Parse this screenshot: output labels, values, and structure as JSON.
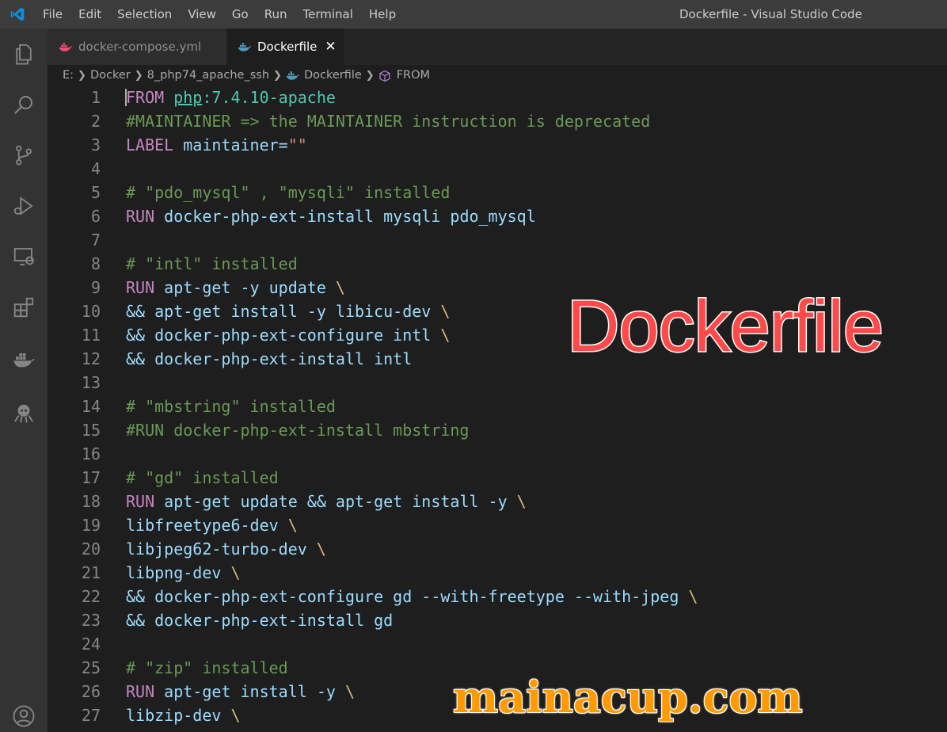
{
  "titlebar": {
    "menu": [
      "File",
      "Edit",
      "Selection",
      "View",
      "Go",
      "Run",
      "Terminal",
      "Help"
    ],
    "window_title": "Dockerfile - Visual Studio Code"
  },
  "activitybar": {
    "icons": [
      "explorer-icon",
      "search-icon",
      "source-control-icon",
      "run-debug-icon",
      "remote-explorer-icon",
      "extensions-icon",
      "docker-icon",
      "github-octocat-icon",
      "account-icon"
    ]
  },
  "tabs": [
    {
      "label": "docker-compose.yml",
      "active": false,
      "icon": "docker-pink-icon"
    },
    {
      "label": "Dockerfile",
      "active": true,
      "icon": "docker-blue-icon",
      "close": "✕"
    }
  ],
  "breadcrumb": [
    "E:",
    "Docker",
    "8_php74_apache_ssh",
    "Dockerfile",
    "FROM"
  ],
  "colors": {
    "keyword": "#c586c0",
    "comment": "#6a9955",
    "text": "#9cdcfe",
    "string": "#ce9178",
    "image": "#4ec9b0",
    "backslash": "#d7ba7d"
  },
  "lines": [
    {
      "n": "1",
      "tokens": [
        {
          "t": "FROM",
          "c": "kw"
        },
        {
          "t": " ",
          "c": "plain"
        },
        {
          "t": "php",
          "c": "img underline"
        },
        {
          "t": ":7.4.10-apache",
          "c": "img"
        }
      ]
    },
    {
      "n": "2",
      "tokens": [
        {
          "t": "#MAINTAINER => the MAINTAINER instruction is deprecated",
          "c": "cm"
        }
      ]
    },
    {
      "n": "3",
      "tokens": [
        {
          "t": "LABEL",
          "c": "kw"
        },
        {
          "t": " maintainer=",
          "c": "tx"
        },
        {
          "t": "\"\"",
          "c": "st"
        }
      ]
    },
    {
      "n": "4",
      "tokens": []
    },
    {
      "n": "5",
      "tokens": [
        {
          "t": "# \"pdo_mysql\" , \"mysqli\" installed",
          "c": "cm"
        }
      ]
    },
    {
      "n": "6",
      "tokens": [
        {
          "t": "RUN",
          "c": "kw"
        },
        {
          "t": " docker-php-ext-install mysqli pdo_mysql",
          "c": "tx"
        }
      ]
    },
    {
      "n": "7",
      "tokens": []
    },
    {
      "n": "8",
      "tokens": [
        {
          "t": "# \"intl\" installed",
          "c": "cm"
        }
      ]
    },
    {
      "n": "9",
      "tokens": [
        {
          "t": "RUN",
          "c": "kw"
        },
        {
          "t": " apt-get -y update ",
          "c": "tx"
        },
        {
          "t": "\\",
          "c": "bs"
        }
      ]
    },
    {
      "n": "10",
      "tokens": [
        {
          "t": "&& apt-get install -y libicu-dev ",
          "c": "tx"
        },
        {
          "t": "\\",
          "c": "bs"
        }
      ]
    },
    {
      "n": "11",
      "tokens": [
        {
          "t": "&& docker-php-ext-configure intl ",
          "c": "tx"
        },
        {
          "t": "\\",
          "c": "bs"
        }
      ]
    },
    {
      "n": "12",
      "tokens": [
        {
          "t": "&& docker-php-ext-install intl",
          "c": "tx"
        }
      ]
    },
    {
      "n": "13",
      "tokens": []
    },
    {
      "n": "14",
      "tokens": [
        {
          "t": "# \"mbstring\" installed",
          "c": "cm"
        }
      ]
    },
    {
      "n": "15",
      "tokens": [
        {
          "t": "#RUN docker-php-ext-install mbstring",
          "c": "cm"
        }
      ]
    },
    {
      "n": "16",
      "tokens": []
    },
    {
      "n": "17",
      "tokens": [
        {
          "t": "# \"gd\" installed",
          "c": "cm"
        }
      ]
    },
    {
      "n": "18",
      "tokens": [
        {
          "t": "RUN",
          "c": "kw"
        },
        {
          "t": " apt-get update && apt-get install -y ",
          "c": "tx"
        },
        {
          "t": "\\",
          "c": "bs"
        }
      ]
    },
    {
      "n": "19",
      "tokens": [
        {
          "t": "libfreetype6-dev ",
          "c": "tx"
        },
        {
          "t": "\\",
          "c": "bs"
        }
      ]
    },
    {
      "n": "20",
      "tokens": [
        {
          "t": "libjpeg62-turbo-dev ",
          "c": "tx"
        },
        {
          "t": "\\",
          "c": "bs"
        }
      ]
    },
    {
      "n": "21",
      "tokens": [
        {
          "t": "libpng-dev ",
          "c": "tx"
        },
        {
          "t": "\\",
          "c": "bs"
        }
      ]
    },
    {
      "n": "22",
      "tokens": [
        {
          "t": "&& docker-php-ext-configure gd --with-freetype --with-jpeg ",
          "c": "tx"
        },
        {
          "t": "\\",
          "c": "bs"
        }
      ]
    },
    {
      "n": "23",
      "tokens": [
        {
          "t": "&& docker-php-ext-install gd",
          "c": "tx"
        }
      ]
    },
    {
      "n": "24",
      "tokens": []
    },
    {
      "n": "25",
      "tokens": [
        {
          "t": "# \"zip\" installed",
          "c": "cm"
        }
      ]
    },
    {
      "n": "26",
      "tokens": [
        {
          "t": "RUN",
          "c": "kw"
        },
        {
          "t": " apt-get install -y ",
          "c": "tx"
        },
        {
          "t": "\\",
          "c": "bs"
        }
      ]
    },
    {
      "n": "27",
      "tokens": [
        {
          "t": "libzip-dev ",
          "c": "tx"
        },
        {
          "t": "\\",
          "c": "bs"
        }
      ]
    }
  ],
  "watermarks": {
    "title": "Dockerfile",
    "site": "mainacup.com"
  }
}
